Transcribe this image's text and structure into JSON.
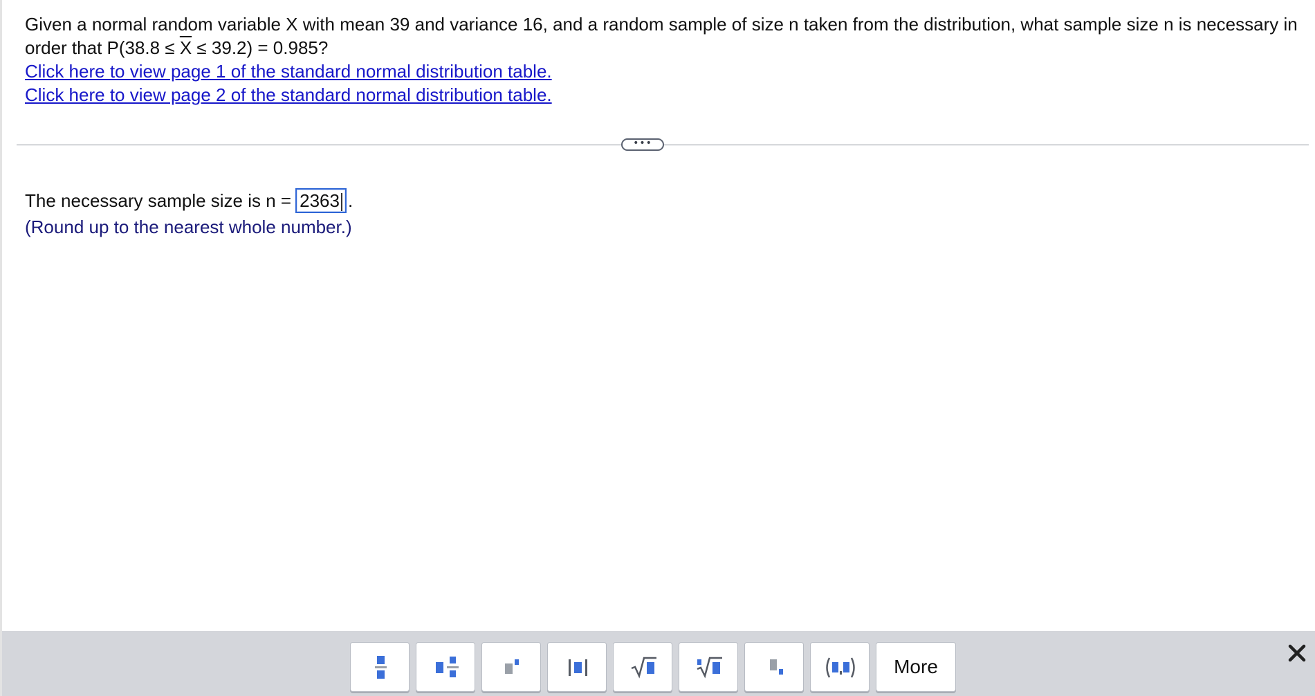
{
  "question": {
    "line1": "Given a normal random variable X with mean 39 and variance 16, and a random sample of size n taken from the distribution, what sample size n is necessary in",
    "line2_prefix": "order that P(38.8 ≤ ",
    "line2_xbar": "X",
    "line2_suffix": " ≤ 39.2) = 0.985?",
    "link1": "Click here to view page 1 of the standard normal distribution table.",
    "link2": "Click here to view page 2 of the standard normal distribution table."
  },
  "divider": {
    "ellipsis": "•••"
  },
  "answer": {
    "prefix": "The necessary sample size is n =",
    "value": "2363",
    "suffix": ".",
    "hint": "(Round up to the nearest whole number.)"
  },
  "toolbar": {
    "more_label": "More",
    "close_label": "✕",
    "buttons": [
      "fraction-icon",
      "mixed-number-icon",
      "exponent-icon",
      "absolute-value-icon",
      "square-root-icon",
      "nth-root-icon",
      "subscript-icon",
      "ordered-pair-icon"
    ]
  },
  "colors": {
    "link": "#1717c9",
    "hint": "#1a1a7a",
    "accent_blue": "#2f66d6",
    "icon_blue": "#3b6fd9",
    "icon_gray": "#9aa0a8",
    "toolbar_bg": "#d4d6db"
  }
}
